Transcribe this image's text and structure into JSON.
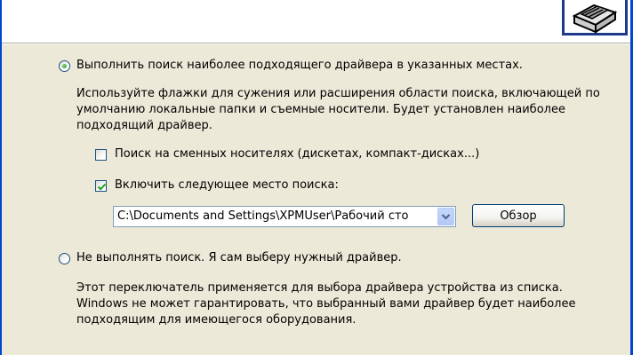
{
  "header": {
    "icon": "hardware-wizard-icon"
  },
  "search_option": {
    "label": "Выполнить поиск наиболее подходящего драйвера в указанных местах.",
    "selected": true,
    "description": "Используйте флажки для сужения или расширения области поиска, включающей по умолчанию локальные папки и съемные носители. Будет установлен наиболее подходящий драйвер.",
    "removable_media_label": "Поиск на сменных носителях (дискетах, компакт-дисках...)",
    "removable_media_checked": false,
    "include_location_label": "Включить следующее место поиска:",
    "include_location_checked": true,
    "path_value": "C:\\Documents and Settings\\XPMUser\\Рабочий сто",
    "browse_label": "Обзор"
  },
  "manual_option": {
    "label": "Не выполнять поиск. Я сам выберу нужный драйвер.",
    "selected": false,
    "description": "Этот переключатель применяется для выбора драйвера устройства из списка. Windows не может гарантировать, что выбранный вами драйвер будет наиболее подходящим для имеющегося оборудования."
  },
  "colors": {
    "dialog_background": "#ece9d8",
    "header_background": "#ffffff",
    "window_frame": "#0047d0",
    "radio_selected": "#21a121",
    "checkmark": "#21a121"
  }
}
